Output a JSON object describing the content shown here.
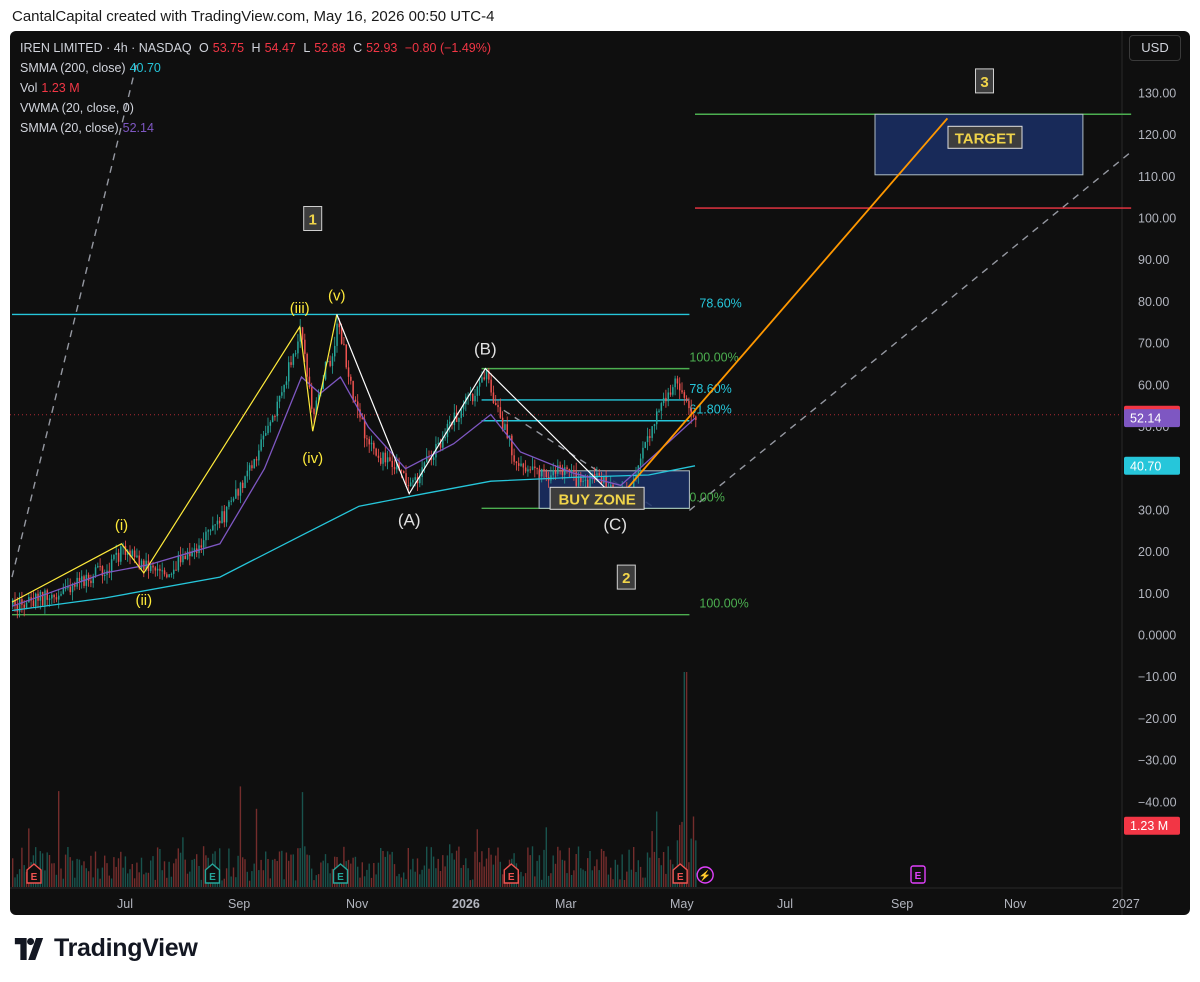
{
  "header": {
    "attribution": "CantalCapital created with TradingView.com, May 16, 2026 00:50 UTC-4"
  },
  "legend": {
    "symbol": "IREN LIMITED · 4h · NASDAQ",
    "o_label": "O",
    "o_value": "53.75",
    "h_label": "H",
    "h_value": "54.47",
    "l_label": "L",
    "l_value": "52.88",
    "c_label": "C",
    "c_value": "52.93",
    "change": "−0.80 (−1.49%)",
    "smma200": "SMMA (200, close)",
    "smma200_value": "40.70",
    "vol": "Vol",
    "vol_value": "1.23 M",
    "vwma": "VWMA (20, close, 0)",
    "smma20": "SMMA (20, close)",
    "smma20_value": "52.14"
  },
  "currency": "USD",
  "brand": {
    "name": "TradingView"
  },
  "colors": {
    "background": "#0f0f0f",
    "up": "#26a69a",
    "down": "#ef5350",
    "smma200": "#26c6da",
    "smma20": "#7e57c2",
    "impulse": "#ffeb3b",
    "projection": "#ff9800",
    "fib_cyan": "#26c6da",
    "fib_green": "#4caf50",
    "target_red": "#f23645",
    "label_yellow": "#f0d44a"
  },
  "chart_data": {
    "type": "candlestick",
    "symbol": "IREN",
    "interval": "4h",
    "ylim": [
      -50,
      136
    ],
    "y_ticks": [
      "130.00",
      "120.00",
      "110.00",
      "100.00",
      "90.00",
      "80.00",
      "70.00",
      "60.00",
      "50.00",
      "40.00",
      "30.00",
      "20.00",
      "10.00",
      "0.0000",
      "−10.00",
      "−20.00",
      "−30.00",
      "−40.00"
    ],
    "x_ticks": [
      "Jul",
      "Sep",
      "Nov",
      "2026",
      "Mar",
      "May",
      "Jul",
      "Sep",
      "Nov",
      "2027"
    ],
    "price_labels": [
      {
        "text": "52.93",
        "value": 52.93,
        "color": "#f23645"
      },
      {
        "text": "52.14",
        "value": 52.14,
        "color": "#7e57c2"
      },
      {
        "text": "40.70",
        "value": 40.7,
        "color": "#26c6da"
      },
      {
        "text": "1.23 M",
        "value": -45.6,
        "color": "#f23645"
      }
    ],
    "price_path": [
      [
        "2025-05-12",
        7
      ],
      [
        "2025-06-05",
        10
      ],
      [
        "2025-07-01",
        16
      ],
      [
        "2025-07-10",
        20
      ],
      [
        "2025-07-22",
        17
      ],
      [
        "2025-08-01",
        15
      ],
      [
        "2025-08-20",
        21
      ],
      [
        "2025-09-05",
        30
      ],
      [
        "2025-09-20",
        42
      ],
      [
        "2025-10-05",
        60
      ],
      [
        "2025-10-14",
        73
      ],
      [
        "2025-10-21",
        53
      ],
      [
        "2025-10-27",
        64
      ],
      [
        "2025-11-01",
        66
      ],
      [
        "2025-11-03",
        76
      ],
      [
        "2025-11-10",
        60
      ],
      [
        "2025-11-20",
        45
      ],
      [
        "2025-12-05",
        40
      ],
      [
        "2025-12-12",
        35
      ],
      [
        "2025-12-22",
        42
      ],
      [
        "2026-01-02",
        50
      ],
      [
        "2026-01-15",
        58
      ],
      [
        "2026-01-22",
        63
      ],
      [
        "2026-01-30",
        52
      ],
      [
        "2026-02-08",
        41
      ],
      [
        "2026-02-20",
        38
      ],
      [
        "2026-03-05",
        40
      ],
      [
        "2026-03-15",
        36
      ],
      [
        "2026-03-25",
        38
      ],
      [
        "2026-04-02",
        33
      ],
      [
        "2026-04-10",
        34
      ],
      [
        "2026-04-18",
        46
      ],
      [
        "2026-04-26",
        56
      ],
      [
        "2026-05-04",
        60
      ],
      [
        "2026-05-10",
        55
      ],
      [
        "2026-05-15",
        52.93
      ]
    ],
    "smma200_path": [
      [
        "2025-05-12",
        6
      ],
      [
        "2025-07-01",
        9
      ],
      [
        "2025-09-01",
        14
      ],
      [
        "2025-10-15",
        24
      ],
      [
        "2025-11-15",
        31
      ],
      [
        "2025-12-20",
        34
      ],
      [
        "2026-01-25",
        37
      ],
      [
        "2026-03-15",
        38
      ],
      [
        "2026-04-20",
        38.5
      ],
      [
        "2026-05-15",
        40.7
      ]
    ],
    "smma20_path": [
      [
        "2025-05-12",
        7
      ],
      [
        "2025-07-01",
        15
      ],
      [
        "2025-07-25",
        17
      ],
      [
        "2025-09-01",
        22
      ],
      [
        "2025-09-25",
        40
      ],
      [
        "2025-10-15",
        62
      ],
      [
        "2025-10-25",
        58
      ],
      [
        "2025-11-05",
        62
      ],
      [
        "2025-11-20",
        50
      ],
      [
        "2025-12-10",
        40
      ],
      [
        "2026-01-05",
        46
      ],
      [
        "2026-01-25",
        53
      ],
      [
        "2026-02-10",
        44
      ],
      [
        "2026-03-10",
        39
      ],
      [
        "2026-04-05",
        36
      ],
      [
        "2026-04-25",
        44
      ],
      [
        "2026-05-15",
        52.14
      ]
    ],
    "impulse_wave": [
      {
        "date": "2025-05-12",
        "value": 8
      },
      {
        "date": "2025-07-10",
        "value": 22,
        "label": "(i)"
      },
      {
        "date": "2025-07-22",
        "value": 15,
        "label": "(ii)"
      },
      {
        "date": "2025-10-14",
        "value": 74,
        "label": "(iii)"
      },
      {
        "date": "2025-10-21",
        "value": 49,
        "label": "(iv)"
      },
      {
        "date": "2025-11-03",
        "value": 77,
        "label": "(v)"
      }
    ],
    "corrective_wave": [
      {
        "date": "2025-11-03",
        "value": 77
      },
      {
        "date": "2025-12-12",
        "value": 34,
        "label": "(A)"
      },
      {
        "date": "2026-01-22",
        "value": 64,
        "label": "(B)"
      },
      {
        "date": "2026-04-02",
        "value": 33,
        "label": "(C)"
      }
    ],
    "projection": [
      {
        "date": "2026-04-08",
        "value": 35
      },
      {
        "date": "2026-09-28",
        "value": 124
      }
    ],
    "degree_labels": [
      {
        "text": "1",
        "date": "2025-10-21",
        "value": 100
      },
      {
        "text": "2",
        "date": "2026-04-08",
        "value": 14
      },
      {
        "text": "3",
        "date": "2026-10-18",
        "value": 133
      }
    ],
    "horizontal_levels": [
      {
        "value": 77,
        "from": "2025-05-12",
        "to": "2026-05-12",
        "color": "#26c6da",
        "label": "78.60%"
      },
      {
        "value": 5,
        "from": "2025-05-12",
        "to": "2026-05-12",
        "color": "#4caf50",
        "label": "100.00%"
      },
      {
        "value": 64,
        "from": "2026-01-20",
        "to": "2026-05-12",
        "color": "#4caf50",
        "label": "100.00%"
      },
      {
        "value": 56.5,
        "from": "2026-01-20",
        "to": "2026-05-12",
        "color": "#26c6da",
        "label": "78.60%"
      },
      {
        "value": 51.5,
        "from": "2026-01-20",
        "to": "2026-05-12",
        "color": "#26c6da",
        "label": "61.80%"
      },
      {
        "value": 30.5,
        "from": "2026-01-20",
        "to": "2026-05-12",
        "color": "#4caf50",
        "label": "0.00%"
      },
      {
        "value": 125,
        "from": "2026-05-15",
        "to": "2027-01-05",
        "color": "#4caf50"
      },
      {
        "value": 102.5,
        "from": "2026-05-15",
        "to": "2027-01-05",
        "color": "#f23645"
      }
    ],
    "zones": [
      {
        "label": "BUY ZONE",
        "from": "2026-02-20",
        "to": "2026-05-12",
        "low": 30.5,
        "high": 39.5
      },
      {
        "label": "TARGET",
        "from": "2026-08-20",
        "to": "2026-12-10",
        "low": 110.5,
        "high": 125
      }
    ],
    "channel_lines": [
      [
        {
          "date": "2025-05-12",
          "value": 14
        },
        {
          "date": "2025-07-18",
          "value": 137
        }
      ],
      [
        {
          "date": "2026-05-12",
          "value": 30
        },
        {
          "date": "2027-01-05",
          "value": 116
        }
      ],
      [
        {
          "date": "2026-02-01",
          "value": 54
        },
        {
          "date": "2026-04-22",
          "value": 31
        }
      ]
    ],
    "earnings_markers": [
      "2025-05-12",
      "2025-08-28",
      "2025-11-05",
      "2026-02-05",
      "2026-05-07"
    ],
    "dividend_marker": "2026-05-14",
    "future_event_marker": "2026-09-10",
    "volume": {
      "peak_value": 38,
      "last_value": 1.23,
      "unit": "M"
    }
  }
}
